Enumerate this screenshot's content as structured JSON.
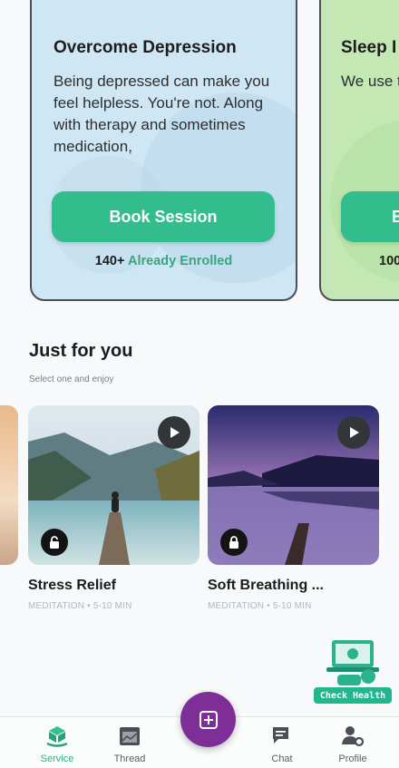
{
  "programs": [
    {
      "title": "Overcome Depression",
      "description": "Being depressed can make you feel helpless. You're not. Along with therapy and sometimes medication,",
      "button_label": "Book Session",
      "enrolled_count": "140+",
      "enrolled_text": "Already Enrolled",
      "bg_color": "#cfe6f4"
    },
    {
      "title": "Sleep I",
      "description": "We use to help beat yo",
      "button_label": "B",
      "enrolled_count": "100",
      "enrolled_text": "",
      "bg_color": "#c3e8b4"
    }
  ],
  "just_for_you": {
    "title": "Just for you",
    "subtitle": "Select one and enjoy",
    "items": [
      {
        "title": "Stress Relief",
        "meta": "MEDITATION • 5-10 MIN"
      },
      {
        "title": "Soft Breathing ...",
        "meta": "MEDITATION • 5-10 MIN"
      }
    ]
  },
  "check_health": {
    "label": "Check Health"
  },
  "bottom_nav": {
    "items": [
      {
        "label": "Service",
        "icon": "service-icon",
        "active": true
      },
      {
        "label": "Thread",
        "icon": "thread-icon",
        "active": false
      },
      {
        "label": "Chat",
        "icon": "chat-icon",
        "active": false
      },
      {
        "label": "Profile",
        "icon": "profile-icon",
        "active": false
      }
    ],
    "fab_icon": "plus-square-icon"
  },
  "colors": {
    "accent_green": "#33bd8c",
    "fab_purple": "#7d2e97"
  }
}
